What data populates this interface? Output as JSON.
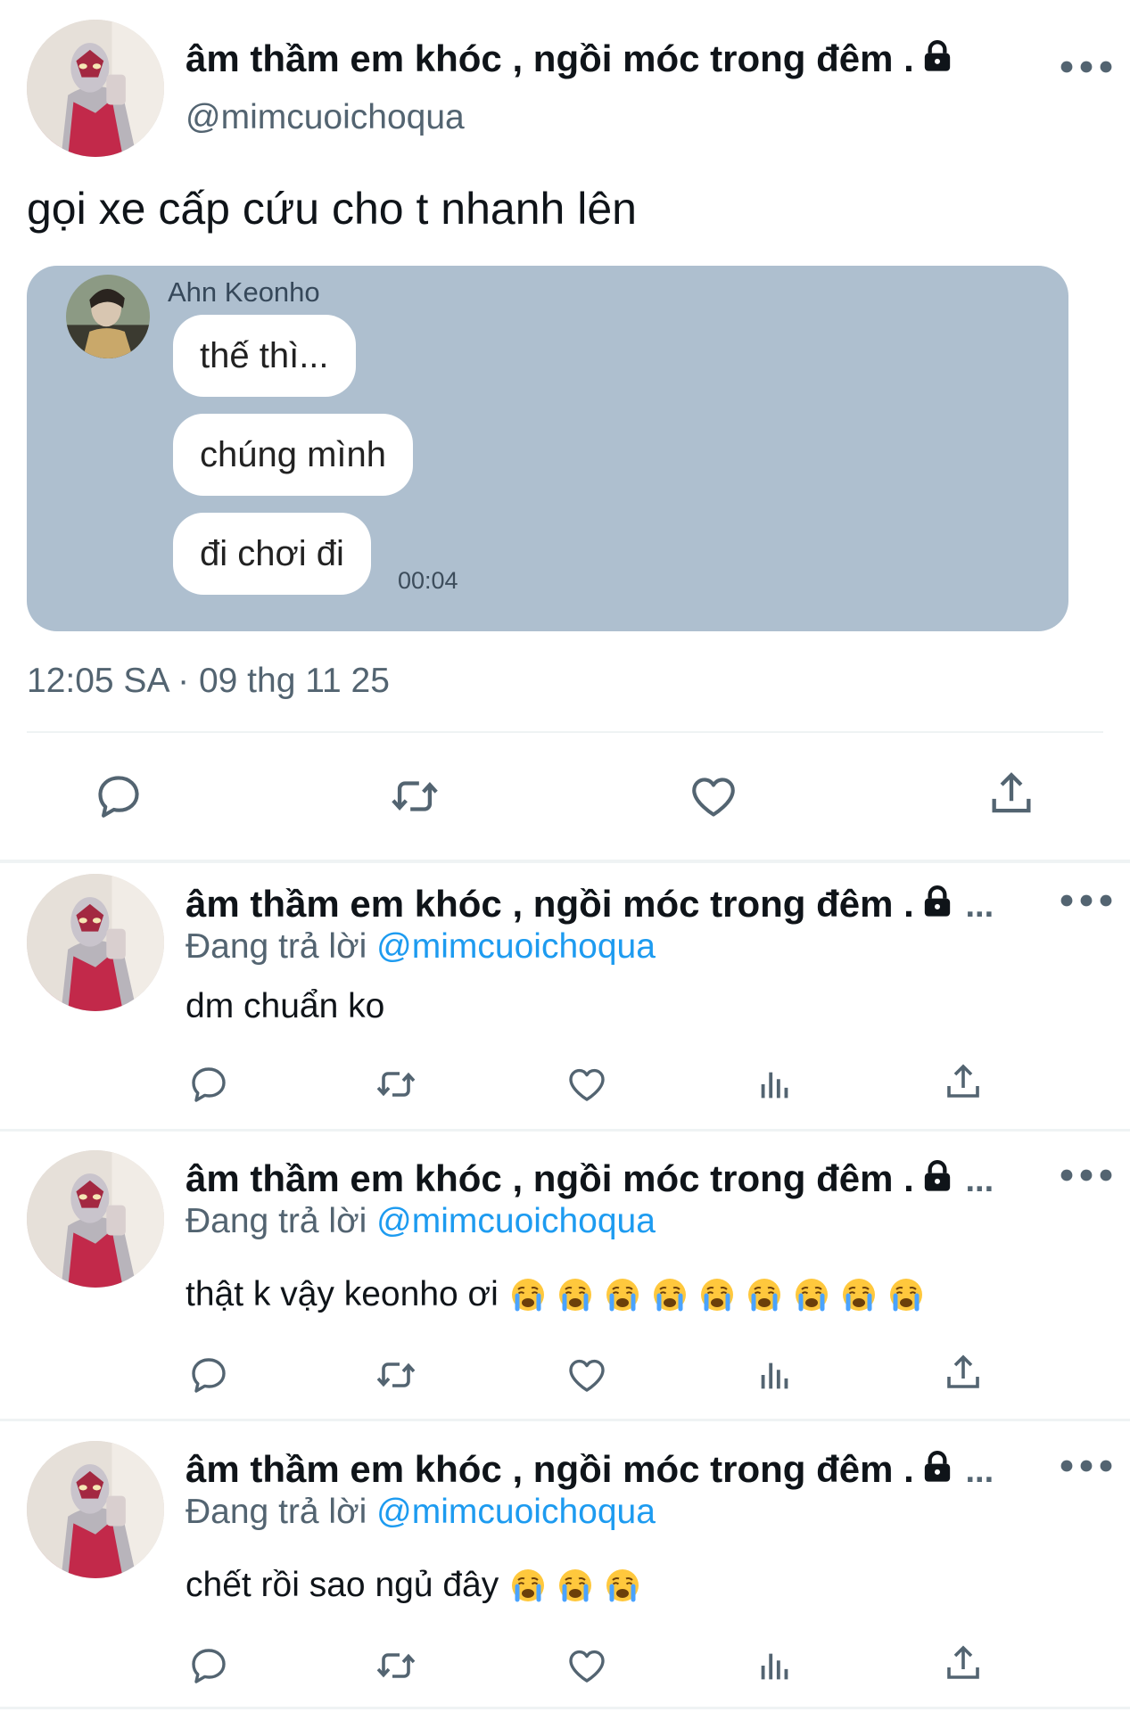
{
  "main_tweet": {
    "display_name": "âm thầm em khóc , ngồi móc trong đêm .",
    "handle": "@mimcuoichoqua",
    "text": "gọi xe cấp cứu cho t nhanh lên",
    "timestamp": "12:05 SA · 09 thg 11 25",
    "more_icon": "more-horizontal-icon",
    "lock_icon": "lock-icon",
    "embedded_chat": {
      "sender": "Ahn Keonho",
      "messages": [
        "thế thì...",
        "chúng mình",
        "đi chơi đi"
      ],
      "time": "00:04",
      "background_color": "#aebfcf"
    },
    "actions": [
      "reply-icon",
      "retweet-icon",
      "like-icon",
      "share-icon"
    ]
  },
  "replies": [
    {
      "display_name": "âm thầm em khóc , ngồi móc trong đêm .",
      "truncation": "...",
      "replying_prefix": "Đang trả lời",
      "replying_to": "@mimcuoichoqua",
      "text": "dm chuẩn ko",
      "emoji_count": 0
    },
    {
      "display_name": "âm thầm em khóc , ngồi móc trong đêm .",
      "truncation": "...",
      "replying_prefix": "Đang trả lời",
      "replying_to": "@mimcuoichoqua",
      "text": "thật k vậy keonho ơi",
      "emoji_count": 9
    },
    {
      "display_name": "âm thầm em khóc , ngồi móc trong đêm .",
      "truncation": "...",
      "replying_prefix": "Đang trả lời",
      "replying_to": "@mimcuoichoqua",
      "text": "chết rồi sao ngủ đây",
      "emoji_count": 3
    }
  ],
  "reply_actions": [
    "reply-icon",
    "retweet-icon",
    "like-icon",
    "views-icon",
    "share-icon"
  ],
  "colors": {
    "text": "#0f1419",
    "secondary": "#536471",
    "accent": "#1d9bf0",
    "divider": "#eff3f4"
  }
}
